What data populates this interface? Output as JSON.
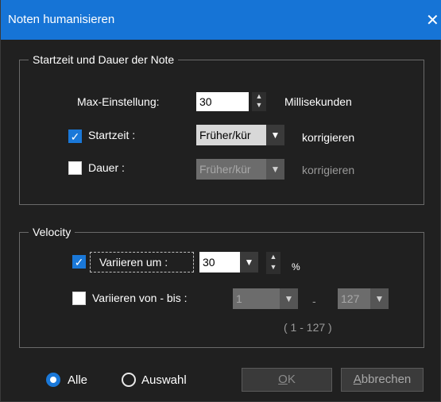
{
  "window": {
    "title": "Noten humanisieren",
    "close_glyph": "✕"
  },
  "group_timing": {
    "label": "Startzeit und Dauer der Note",
    "max_label": "Max-Einstellung:",
    "max_value": "30",
    "max_unit": "Millisekunden",
    "startzeit": {
      "label": "Startzeit :",
      "checked": true,
      "combo": "Früher/kür",
      "action": "korrigieren"
    },
    "dauer": {
      "label": "Dauer :",
      "checked": false,
      "combo": "Früher/kür",
      "action": "korrigieren"
    }
  },
  "group_velocity": {
    "label": "Velocity",
    "variieren_um": {
      "label": "Variieren um :",
      "checked": true,
      "value": "30",
      "unit": "%"
    },
    "variieren_von_bis": {
      "label": "Variieren von - bis :",
      "checked": false,
      "from": "1",
      "sep": "-",
      "to": "127",
      "range_hint": "( 1 - 127 )"
    }
  },
  "footer": {
    "radio_alle": "Alle",
    "radio_auswahl": "Auswahl",
    "selected": "Alle",
    "ok_label": "OK",
    "ok_mnemonic": "O",
    "ok_rest": "K",
    "cancel_mnemonic": "A",
    "cancel_rest": "bbrechen"
  },
  "colors": {
    "accent": "#1674d6",
    "background": "#202020"
  }
}
